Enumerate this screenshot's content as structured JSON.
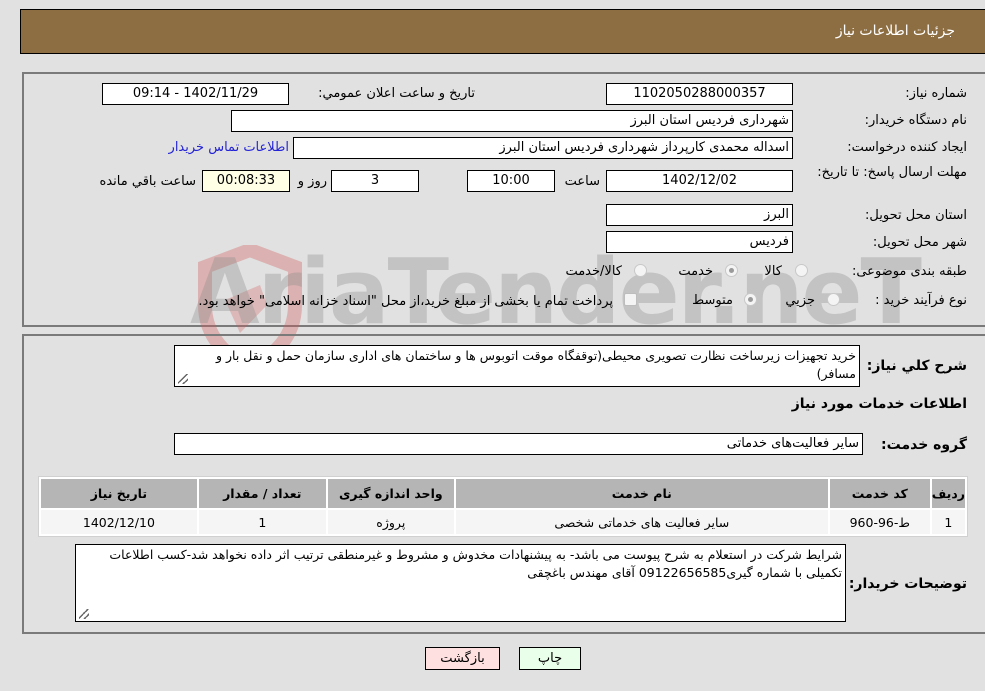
{
  "header": {
    "title": "جزئیات اطلاعات نیاز"
  },
  "form": {
    "need_number": {
      "label": "شماره نیاز:",
      "value": "1102050288000357"
    },
    "announce_datetime": {
      "label": "تاریخ و ساعت اعلان عمومي:",
      "value": "1402/11/29 - 09:14"
    },
    "buyer_org": {
      "label": "نام دستگاه خریدار:",
      "value": "شهرداری فردیس استان البرز"
    },
    "requester": {
      "label": "ایجاد کننده درخواست:",
      "value": "اسداله محمدی کارپرداز شهرداری فردیس استان البرز"
    },
    "buyer_contact_link": "اطلاعات تماس خریدار",
    "deadline": {
      "label": "مهلت ارسال پاسخ: تا تاریخ:",
      "date": "1402/12/02",
      "time_label": "ساعت",
      "time": "10:00",
      "days": "3",
      "days_label": "روز و",
      "remaining": "00:08:33",
      "remaining_label": "ساعت باقي مانده"
    },
    "delivery_province": {
      "label": "استان محل تحویل:",
      "value": "البرز"
    },
    "delivery_city": {
      "label": "شهر محل تحویل:",
      "value": "فردیس"
    },
    "category": {
      "label": "طبقه بندی موضوعی:",
      "options": [
        "کالا",
        "خدمت",
        "کالا/خدمت"
      ],
      "selected": "خدمت"
    },
    "purchase_type": {
      "label": "نوع فرآیند خرید :",
      "options": [
        "جزيي",
        "متوسط"
      ],
      "selected": "متوسط",
      "treasury_note": "پرداخت تمام یا بخشی از مبلغ خرید،از محل \"اسناد خزانه اسلامی\" خواهد بود.",
      "treasury_checked": false
    }
  },
  "description": {
    "label": "شرح کلي نیاز:",
    "value": "خرید تجهیزات زیرساخت نظارت تصویری محیطی(توقفگاه موقت اتوبوس ها و ساختمان های اداری سازمان حمل و نقل بار و مسافر)"
  },
  "services_section": {
    "title": "اطلاعات خدمات مورد نیاز",
    "group_label": "گروه خدمت:",
    "group_value": "سایر فعالیت‌های خدماتی",
    "table": {
      "headers": [
        "ردیف",
        "کد خدمت",
        "نام خدمت",
        "واحد اندازه گیری",
        "تعداد / مقدار",
        "تاریخ نیاز"
      ],
      "rows": [
        [
          "1",
          "ط-96-960",
          "سایر فعالیت های خدماتی شخصی",
          "پروژه",
          "1",
          "1402/12/10"
        ]
      ]
    }
  },
  "buyer_notes": {
    "label": "توضیحات خریدار:",
    "value": "شرایط شرکت در استعلام به شرح پیوست می باشد- به پیشنهادات مخدوش و مشروط و غیرمنطقی ترتیب اثر داده نخواهد شد-کسب اطلاعات تکمیلی با شماره گیری09122656585 آقای مهندس باغچقی"
  },
  "buttons": {
    "print": "چاپ",
    "back": "بازگشت"
  },
  "watermark": "AriaTender.neT",
  "colors": {
    "header_bg": "#8d6e43",
    "link": "#2424d6",
    "back_btn": "#ffe0e0",
    "print_btn": "#eaffea",
    "remaining_bg": "#ffffe6"
  }
}
